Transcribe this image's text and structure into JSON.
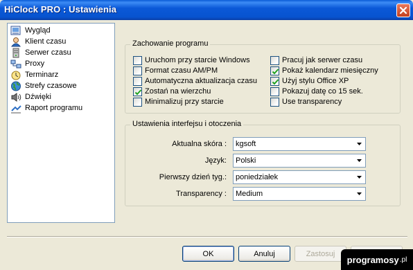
{
  "window": {
    "title": "HiClock PRO : Ustawienia",
    "close_icon": "close-icon"
  },
  "sidebar": {
    "items": [
      {
        "label": "Wygląd",
        "icon": "appearance-icon"
      },
      {
        "label": "Klient czasu",
        "icon": "time-client-icon"
      },
      {
        "label": "Serwer czasu",
        "icon": "time-server-icon"
      },
      {
        "label": "Proxy",
        "icon": "proxy-icon"
      },
      {
        "label": "Terminarz",
        "icon": "scheduler-icon"
      },
      {
        "label": "Strefy czasowe",
        "icon": "globe-icon"
      },
      {
        "label": "Dźwięki",
        "icon": "speaker-icon"
      },
      {
        "label": "Raport programu",
        "icon": "report-icon"
      }
    ]
  },
  "behavior": {
    "title": "Zachowanie programu",
    "left": [
      {
        "label": "Uruchom przy starcie Windows",
        "checked": false
      },
      {
        "label": "Format czasu AM/PM",
        "checked": false
      },
      {
        "label": "Automatyczna aktualizacja czasu",
        "checked": false
      },
      {
        "label": "Zostań na wierzchu",
        "checked": true
      },
      {
        "label": "Minimalizuj przy starcie",
        "checked": false
      }
    ],
    "right": [
      {
        "label": "Pracuj jak serwer czasu",
        "checked": false
      },
      {
        "label": "Pokaż kalendarz miesięczny",
        "checked": true
      },
      {
        "label": "Użyj stylu Office XP",
        "checked": true
      },
      {
        "label": "Pokazuj datę co 15 sek.",
        "checked": false
      },
      {
        "label": "Use transparency",
        "checked": false
      }
    ]
  },
  "interface": {
    "title": "Ustawienia interfejsu i otoczenia",
    "fields": [
      {
        "label": "Aktualna skóra :",
        "value": "kgsoft"
      },
      {
        "label": "Język:",
        "value": "Polski"
      },
      {
        "label": "Pierwszy dzień tyg.:",
        "value": "poniedziałek"
      },
      {
        "label": "Transparency :",
        "value": "Medium"
      }
    ]
  },
  "buttons": {
    "ok": "OK",
    "cancel": "Anuluj",
    "apply": "Zastosuj"
  },
  "watermark": {
    "name": "programosy",
    "tld": ".pl"
  },
  "colors": {
    "titlebar": "#0753cf",
    "window_bg": "#ece9d8",
    "check_mark": "#21a121"
  }
}
